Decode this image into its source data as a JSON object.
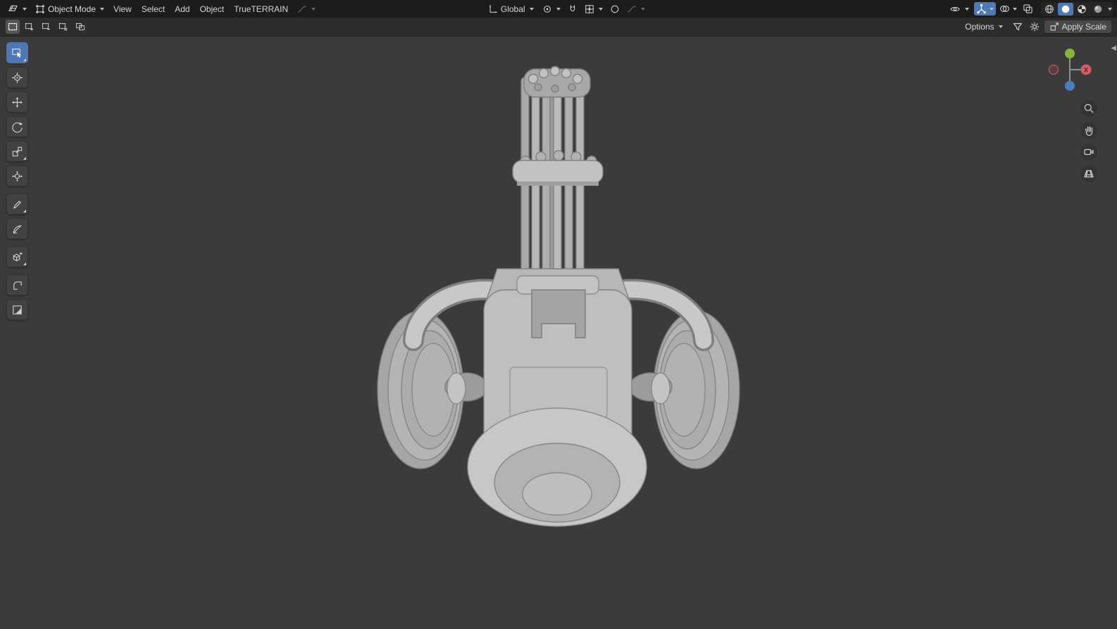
{
  "colors": {
    "accent_blue": "#4e7ab5",
    "header_bg": "#1c1c1c",
    "tool_header_bg": "#2d2d2d",
    "viewport_bg": "#3b3b3b",
    "axis_x": "#d65c64",
    "axis_y": "#84b43c",
    "axis_z": "#4a7fbd",
    "model_gray": "#bfbfbf"
  },
  "topbar": {
    "mode": "Object Mode",
    "menus": [
      "View",
      "Select",
      "Add",
      "Object",
      "TrueTERRAIN"
    ],
    "orientation": "Global"
  },
  "tool_header": {
    "options_label": "Options",
    "apply_scale_label": "Apply Scale"
  },
  "left_toolbar": {
    "active_tool": "select-box",
    "tools": [
      "select-box",
      "cursor",
      "move",
      "rotate",
      "scale",
      "transform",
      "annotate",
      "measure",
      "add-cube",
      "extra-tool-1",
      "extra-tool-2"
    ]
  },
  "nav_gizmo": {
    "x_label": "X"
  },
  "viewport": {
    "model_description": "gray minigun / gatling gun model, solid shading"
  }
}
